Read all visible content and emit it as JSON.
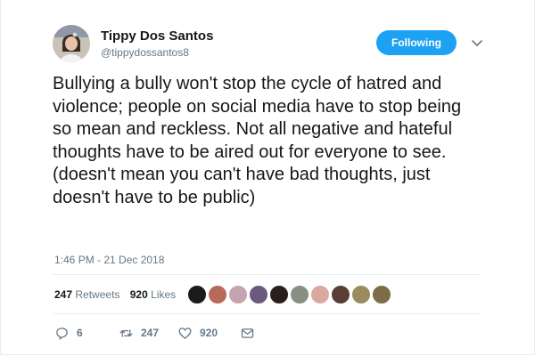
{
  "user": {
    "name": "Tippy Dos Santos",
    "handle": "@tippydossantos8",
    "follow_label": "Following"
  },
  "tweet": {
    "text": "Bullying a bully won't stop the cycle of hatred and violence; people on social media have to stop being so mean and reckless. Not all negative and hateful thoughts have to be aired out for everyone to see. (doesn't mean you can't have bad thoughts, just doesn't have to be public)",
    "timestamp": "1:46 PM - 21 Dec 2018"
  },
  "stats": {
    "retweets_count": "247",
    "retweets_label": "Retweets",
    "likes_count": "920",
    "likes_label": "Likes"
  },
  "actions": {
    "reply_count": "6",
    "retweet_count": "247",
    "like_count": "920"
  },
  "colors": {
    "accent": "#1da1f2",
    "text": "#14171a",
    "muted": "#657786",
    "divider": "#e6ecf0"
  },
  "icons": [
    "chevron-down-icon",
    "reply-icon",
    "retweet-icon",
    "heart-icon",
    "message-icon"
  ]
}
